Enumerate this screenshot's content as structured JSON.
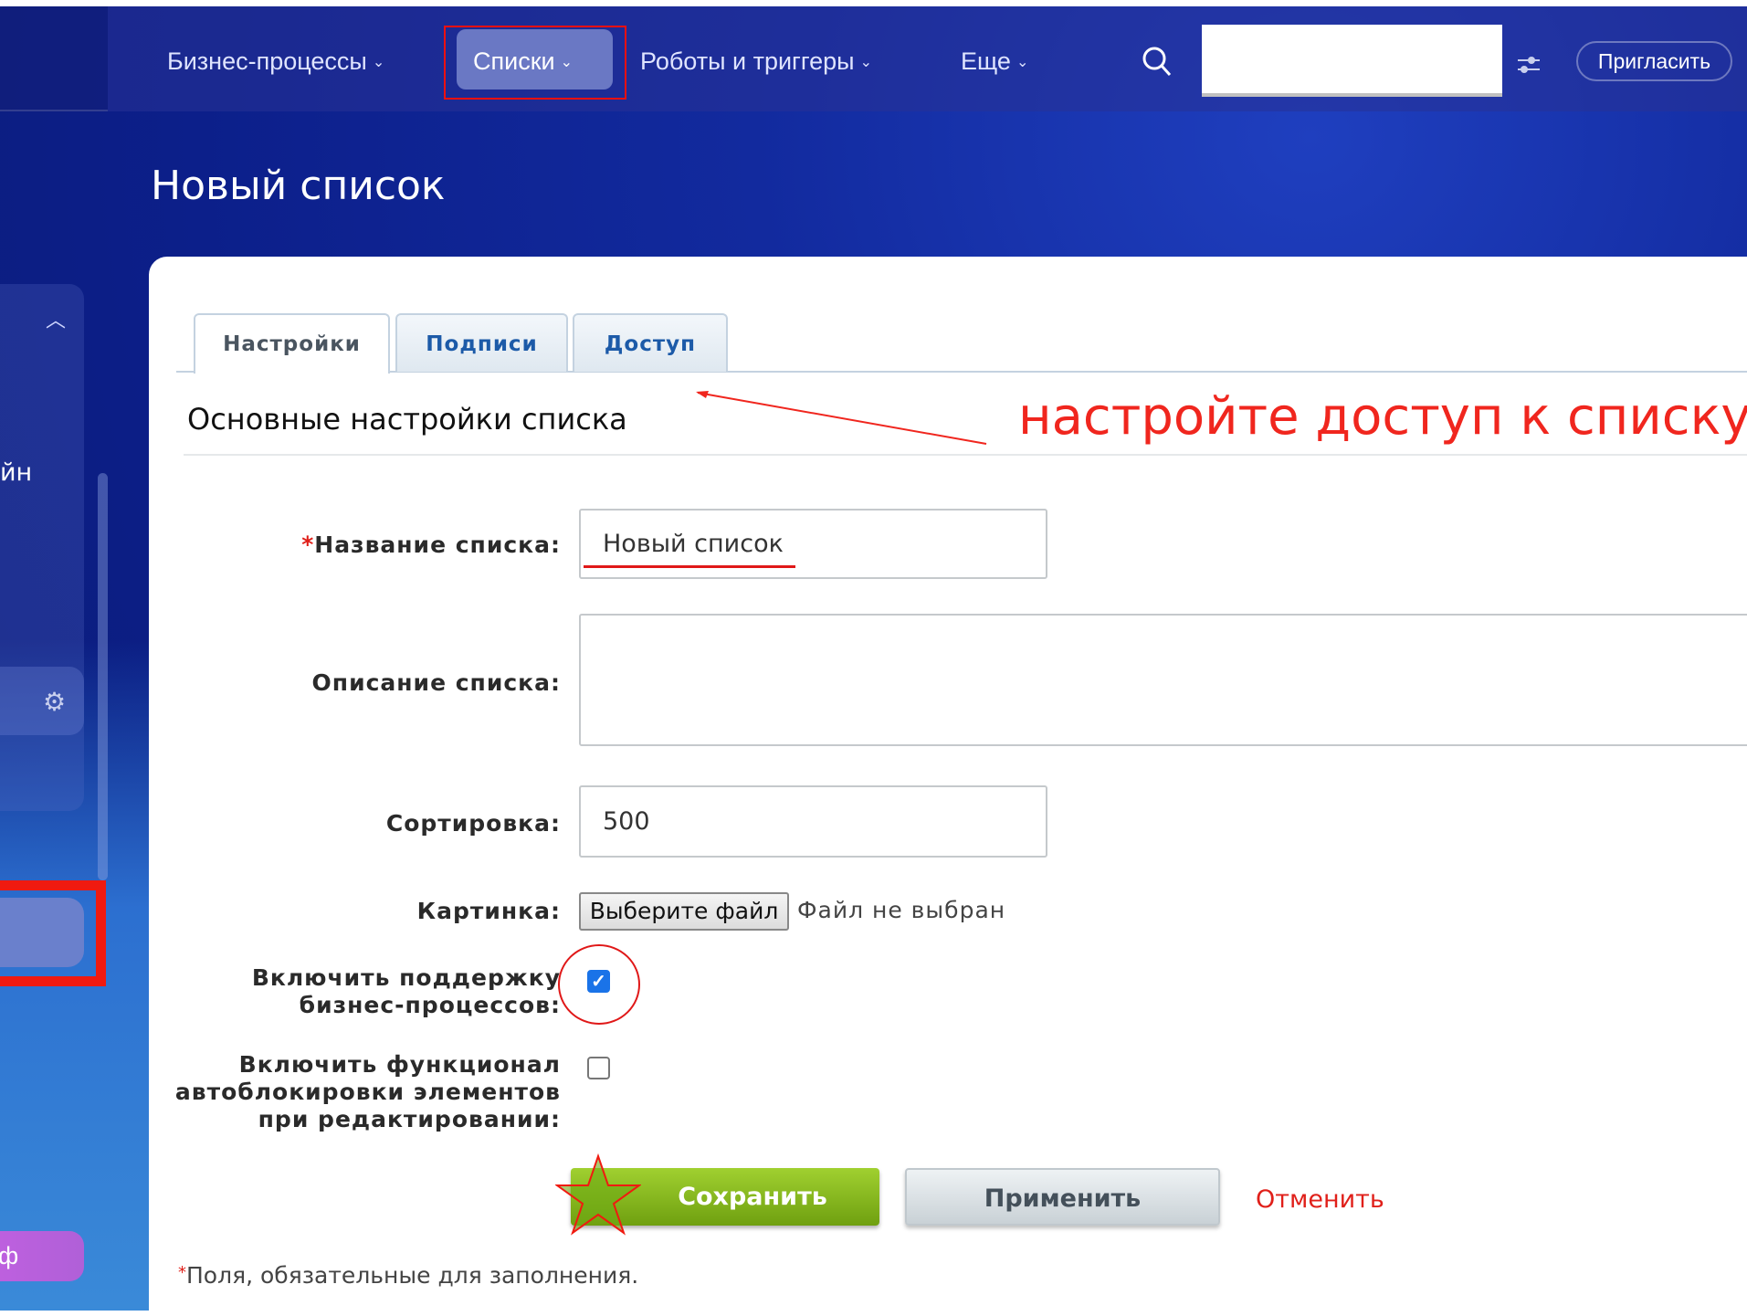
{
  "nav": {
    "items": [
      {
        "label": "Бизнес-процессы"
      },
      {
        "label": "Списки"
      },
      {
        "label": "Роботы и триггеры"
      },
      {
        "label": "Еще"
      }
    ],
    "invite_label": "Пригласить"
  },
  "sidebar": {
    "partial_text": "йн",
    "tariff_partial": "ф"
  },
  "page_title": "Новый список",
  "tabs": [
    {
      "label": "Настройки",
      "active": true
    },
    {
      "label": "Подписи"
    },
    {
      "label": "Доступ"
    }
  ],
  "section_title": "Основные настройки списка",
  "annotation": "настройте доступ к списку",
  "form": {
    "required_mark": "*",
    "name_label": "Название списка:",
    "name_value": "Новый список",
    "description_label": "Описание списка:",
    "description_value": "",
    "sort_label": "Сортировка:",
    "sort_value": "500",
    "picture_label": "Картинка:",
    "choose_file": "Выберите файл",
    "no_file": "Файл не выбран",
    "bp_label_1": "Включить поддержку",
    "bp_label_2": "бизнес-процессов:",
    "bp_checked": true,
    "lock_label_1": "Включить функционал",
    "lock_label_2": "автоблокировки элементов",
    "lock_label_3": "при редактировании:",
    "lock_checked": false
  },
  "buttons": {
    "save": "Сохранить",
    "apply": "Применить",
    "cancel": "Отменить"
  },
  "footnote_mark": "*",
  "footnote": "Поля, обязательные для заполнения.",
  "colors": {
    "accent_red": "#f0261e",
    "save_green": "#8cc020",
    "link_blue": "#1c5aa8"
  }
}
